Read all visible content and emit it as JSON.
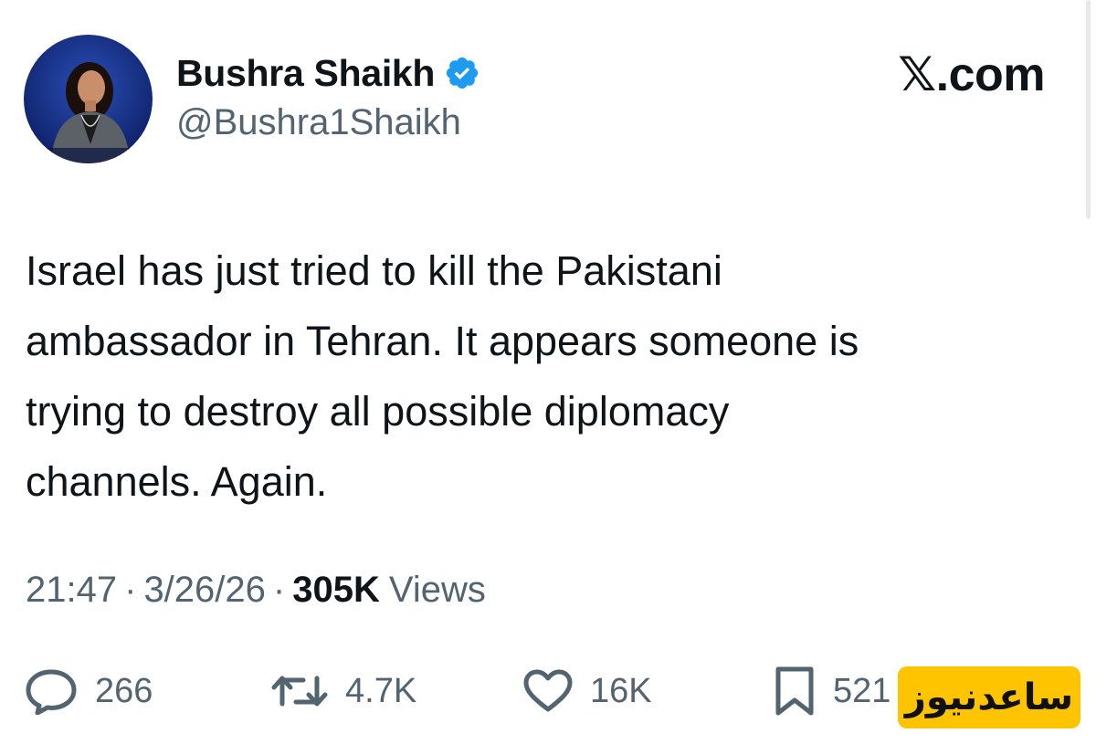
{
  "author": {
    "display_name": "Bushra Shaikh",
    "handle": "@Bushra1Shaikh",
    "verified_color": "#1d9bf0"
  },
  "site_brand": "𝕏.com",
  "tweet": {
    "lines": [
      "Israel has just tried to kill the Pakistani",
      "ambassador in Tehran. It appears someone is",
      "trying to destroy all possible diplomacy",
      "channels. Again."
    ]
  },
  "meta": {
    "time": "21:47",
    "separator": "·",
    "date": "3/26/26",
    "views_count": "305K",
    "views_label": "Views"
  },
  "actions": {
    "replies": "266",
    "reposts": "4.7K",
    "likes": "16K",
    "bookmarks": "521"
  },
  "watermark": {
    "text": "ساعدنیوز",
    "background": "#ffc400"
  },
  "colors": {
    "text_primary": "#0f1419",
    "text_secondary": "#536471",
    "accent": "#1d9bf0"
  }
}
